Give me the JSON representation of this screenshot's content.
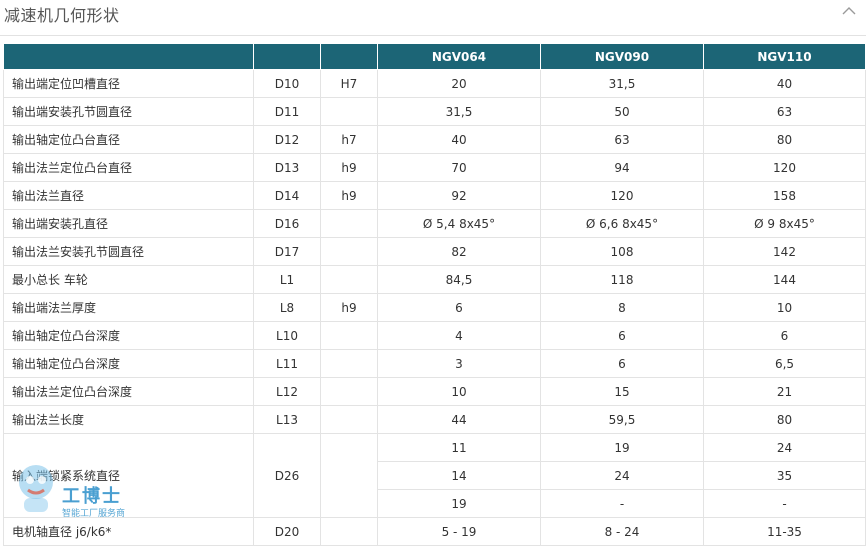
{
  "header": {
    "title": "减速机几何形状"
  },
  "table": {
    "columns": [
      "",
      "",
      "",
      "NGV064",
      "NGV090",
      "NGV110"
    ],
    "rows": [
      {
        "name": "输出端定位凹槽直径",
        "code": "D10",
        "tol": "H7",
        "v1": "20",
        "v2": "31,5",
        "v3": "40"
      },
      {
        "name": "输出端安装孔节圆直径",
        "code": "D11",
        "tol": "",
        "v1": "31,5",
        "v2": "50",
        "v3": "63"
      },
      {
        "name": "输出轴定位凸台直径",
        "code": "D12",
        "tol": "h7",
        "v1": "40",
        "v2": "63",
        "v3": "80"
      },
      {
        "name": "输出法兰定位凸台直径",
        "code": "D13",
        "tol": "h9",
        "v1": "70",
        "v2": "94",
        "v3": "120"
      },
      {
        "name": "输出法兰直径",
        "code": "D14",
        "tol": "h9",
        "v1": "92",
        "v2": "120",
        "v3": "158"
      },
      {
        "name": "输出端安装孔直径",
        "code": "D16",
        "tol": "",
        "v1": "Ø 5,4 8x45°",
        "v2": "Ø 6,6 8x45°",
        "v3": "Ø 9 8x45°"
      },
      {
        "name": "输出法兰安装孔节圆直径",
        "code": "D17",
        "tol": "",
        "v1": "82",
        "v2": "108",
        "v3": "142"
      },
      {
        "name": "最小总长 车轮",
        "code": "L1",
        "tol": "",
        "v1": "84,5",
        "v2": "118",
        "v3": "144"
      },
      {
        "name": "输出端法兰厚度",
        "code": "L8",
        "tol": "h9",
        "v1": "6",
        "v2": "8",
        "v3": "10"
      },
      {
        "name": "输出轴定位凸台深度",
        "code": "L10",
        "tol": "",
        "v1": "4",
        "v2": "6",
        "v3": "6"
      },
      {
        "name": "输出轴定位凸台深度",
        "code": "L11",
        "tol": "",
        "v1": "3",
        "v2": "6",
        "v3": "6,5"
      },
      {
        "name": "输出法兰定位凸台深度",
        "code": "L12",
        "tol": "",
        "v1": "10",
        "v2": "15",
        "v3": "21"
      },
      {
        "name": "输出法兰长度",
        "code": "L13",
        "tol": "",
        "v1": "44",
        "v2": "59,5",
        "v3": "80"
      }
    ],
    "d26": {
      "name": "输入端锁紧系统直径",
      "code": "D26",
      "rows": [
        {
          "v1": "11",
          "v2": "19",
          "v3": "24"
        },
        {
          "v1": "14",
          "v2": "24",
          "v3": "35"
        },
        {
          "v1": "19",
          "v2": "-",
          "v3": "-"
        }
      ]
    },
    "last": {
      "name": "电机轴直径 j6/k6*",
      "code": "D20",
      "tol": "",
      "v1": "5 - 19",
      "v2": "8 - 24",
      "v3": "11-35"
    }
  },
  "watermark": {
    "text": "工博士",
    "sub": "智能工厂服务商",
    "url": "www.gongboshi.com",
    "color": "#2b8fc9"
  },
  "colors": {
    "header_bg": "#1c6576",
    "grid": "#e3e3e3"
  }
}
